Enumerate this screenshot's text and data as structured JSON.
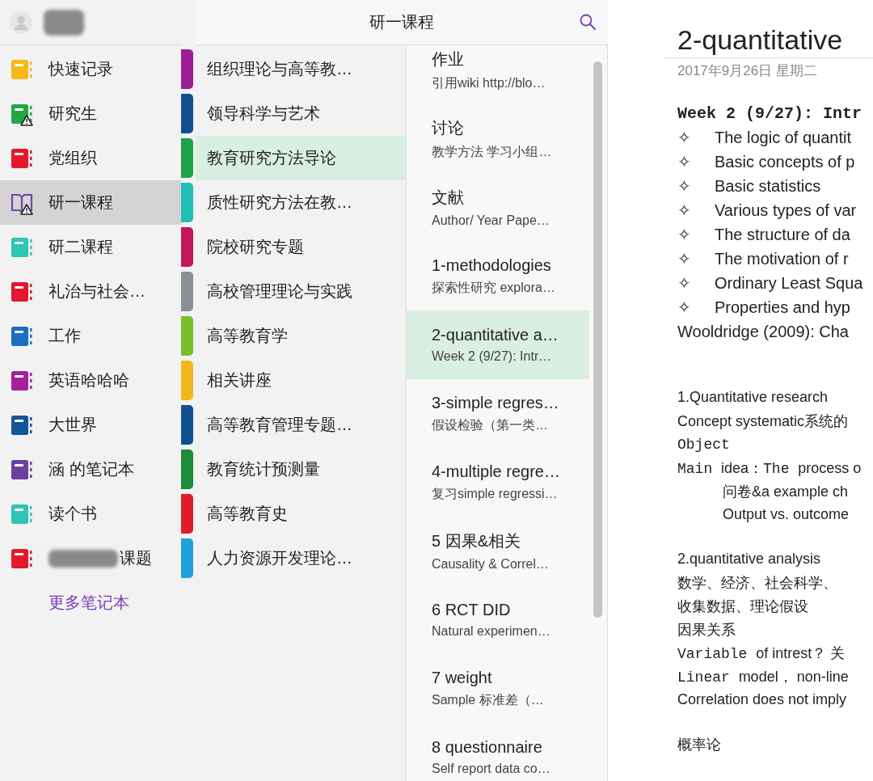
{
  "account": {
    "name_redacted": true
  },
  "notebooks": [
    {
      "name": "快速记录",
      "color": "#f6b818",
      "kind": "notebook",
      "warning": false,
      "selected": false
    },
    {
      "name": "研究生",
      "color": "#21a745",
      "kind": "notebook",
      "warning": true,
      "selected": false
    },
    {
      "name": "党组织",
      "color": "#e3182d",
      "kind": "notebook",
      "warning": false,
      "selected": false
    },
    {
      "name": "研一课程",
      "color": "#6e4aa0",
      "kind": "open-book",
      "warning": true,
      "selected": true
    },
    {
      "name": "研二课程",
      "color": "#2ec4b6",
      "kind": "notebook",
      "warning": false,
      "selected": false
    },
    {
      "name": "礼治与社会…",
      "color": "#e3182d",
      "kind": "notebook",
      "warning": false,
      "selected": false
    },
    {
      "name": "工作",
      "color": "#1a6fbf",
      "kind": "notebook",
      "warning": false,
      "selected": false
    },
    {
      "name": "英语哈哈哈",
      "color": "#a4219a",
      "kind": "notebook",
      "warning": false,
      "selected": false
    },
    {
      "name": "大世界",
      "color": "#15549a",
      "kind": "notebook",
      "warning": false,
      "selected": false
    },
    {
      "name": "涵 的笔记本",
      "color": "#6b3fa0",
      "kind": "notebook",
      "warning": false,
      "selected": false
    },
    {
      "name": "读个书",
      "color": "#2ec4b6",
      "kind": "notebook",
      "warning": false,
      "selected": false
    },
    {
      "name": "课题",
      "color": "#e3182d",
      "kind": "notebook",
      "warning": false,
      "selected": false,
      "redacted_prefix": true
    }
  ],
  "more_notebooks": "更多笔记本",
  "header": {
    "title": "研一课程"
  },
  "sections": [
    {
      "name": "组织理论与高等教…",
      "color": "#9c1d97",
      "selected": false
    },
    {
      "name": "领导科学与艺术",
      "color": "#12508f",
      "selected": false
    },
    {
      "name": "教育研究方法导论",
      "color": "#1ea24a",
      "selected": true
    },
    {
      "name": "质性研究方法在教…",
      "color": "#22bfb5",
      "selected": false
    },
    {
      "name": "院校研究专题",
      "color": "#c4165a",
      "selected": false
    },
    {
      "name": "高校管理理论与实践",
      "color": "#8a9095",
      "selected": false
    },
    {
      "name": "高等教育学",
      "color": "#7bbf2a",
      "selected": false
    },
    {
      "name": "相关讲座",
      "color": "#f2b81b",
      "selected": false
    },
    {
      "name": "高等教育管理专题…",
      "color": "#10508f",
      "selected": false
    },
    {
      "name": "教育统计预测量",
      "color": "#1e8c3a",
      "selected": false
    },
    {
      "name": "高等教育史",
      "color": "#e01c2c",
      "selected": false
    },
    {
      "name": "人力资源开发理论…",
      "color": "#1fa0db",
      "selected": false
    }
  ],
  "pages": [
    {
      "title": "作业",
      "preview": "引用wiki  http://blo…",
      "selected": false
    },
    {
      "title": "讨论",
      "preview": "教学方法  学习小组…",
      "selected": false
    },
    {
      "title": "文献",
      "preview": "Author/ Year  Pape…",
      "selected": false
    },
    {
      "title": "1-methodologies",
      "preview": "探索性研究 explora…",
      "selected": false
    },
    {
      "title": "2-quantitative a…",
      "preview": "Week 2 (9/27): Intr…",
      "selected": true
    },
    {
      "title": "3-simple regres…",
      "preview": "假设检验（第一类…",
      "selected": false
    },
    {
      "title": "4-multiple regre…",
      "preview": "复习simple regressi…",
      "selected": false
    },
    {
      "title": "5 因果&相关",
      "preview": "Causality & Correl…",
      "selected": false
    },
    {
      "title": "6 RCT DID",
      "preview": "Natural experimen…",
      "selected": false
    },
    {
      "title": "7 weight",
      "preview": "Sample  标准差（…",
      "selected": false
    },
    {
      "title": "8 questionnaire",
      "preview": "Self report data co…",
      "selected": false
    }
  ],
  "note": {
    "title": "2-quantitative",
    "date": "2017年9月26日  星期二",
    "lines": [
      {
        "kind": "gap"
      },
      {
        "kind": "text",
        "parts": [
          {
            "kind": "mono-bold",
            "text": "Week 2 (9/27): Intr"
          }
        ]
      },
      {
        "kind": "bullet",
        "marker": "✧",
        "parts": [
          {
            "kind": "sans",
            "text": "The logic of quantit"
          }
        ]
      },
      {
        "kind": "bullet",
        "marker": "✧",
        "parts": [
          {
            "kind": "sans",
            "text": "Basic concepts of p"
          }
        ]
      },
      {
        "kind": "bullet",
        "marker": "✧",
        "parts": [
          {
            "kind": "sans",
            "text": "Basic statistics"
          }
        ]
      },
      {
        "kind": "bullet",
        "marker": "✧",
        "parts": [
          {
            "kind": "sans",
            "text": "Various types of var"
          }
        ]
      },
      {
        "kind": "bullet",
        "marker": "✧",
        "parts": [
          {
            "kind": "sans",
            "text": "The structure of da"
          }
        ]
      },
      {
        "kind": "bullet",
        "marker": "✧",
        "parts": [
          {
            "kind": "sans",
            "text": "The motivation of r"
          }
        ]
      },
      {
        "kind": "bullet",
        "marker": "✧",
        "parts": [
          {
            "kind": "sans",
            "text": "Ordinary Least Squa"
          }
        ]
      },
      {
        "kind": "bullet",
        "marker": "✧",
        "parts": [
          {
            "kind": "sans",
            "text": "Properties and hyp"
          }
        ]
      },
      {
        "kind": "text",
        "parts": [
          {
            "kind": "sans",
            "text": "Wooldridge (2009): Cha"
          }
        ]
      },
      {
        "kind": "gap"
      },
      {
        "kind": "gap"
      },
      {
        "kind": "small",
        "parts": [
          {
            "kind": "sans",
            "text": "1.Quantitative research"
          }
        ]
      },
      {
        "kind": "small",
        "parts": [
          {
            "kind": "sans",
            "text": "Concept systematic系统的"
          }
        ]
      },
      {
        "kind": "small",
        "parts": [
          {
            "kind": "mono",
            "text": "Object"
          }
        ]
      },
      {
        "kind": "small",
        "parts": [
          {
            "kind": "mono",
            "text": "Main "
          },
          {
            "kind": "sans",
            "text": "idea："
          },
          {
            "kind": "mono",
            "text": "The "
          },
          {
            "kind": "sans",
            "text": "process o"
          }
        ]
      },
      {
        "kind": "indent",
        "parts": [
          {
            "kind": "sans",
            "text": "问卷&a example ch"
          }
        ]
      },
      {
        "kind": "indent",
        "parts": [
          {
            "kind": "sans",
            "text": "Output vs. outcome"
          }
        ]
      },
      {
        "kind": "gap"
      },
      {
        "kind": "small",
        "parts": [
          {
            "kind": "sans",
            "text": "2.quantitative analysis"
          }
        ]
      },
      {
        "kind": "small",
        "parts": [
          {
            "kind": "sans",
            "text": "数学、经济、社会科学、"
          }
        ]
      },
      {
        "kind": "small",
        "parts": [
          {
            "kind": "sans",
            "text": "收集数据、理论假设"
          }
        ]
      },
      {
        "kind": "small",
        "parts": [
          {
            "kind": "sans",
            "text": "因果关系"
          }
        ]
      },
      {
        "kind": "small",
        "parts": [
          {
            "kind": "mono",
            "text": "Variable "
          },
          {
            "kind": "sans",
            "text": "of intrest？ 关"
          }
        ]
      },
      {
        "kind": "small",
        "parts": [
          {
            "kind": "mono",
            "text": "Linear "
          },
          {
            "kind": "sans",
            "text": "model， non-line"
          }
        ]
      },
      {
        "kind": "small",
        "parts": [
          {
            "kind": "sans",
            "text": "Correlation does not imply"
          }
        ]
      },
      {
        "kind": "gap"
      },
      {
        "kind": "small",
        "parts": [
          {
            "kind": "sans",
            "text": "概率论"
          }
        ]
      }
    ]
  }
}
